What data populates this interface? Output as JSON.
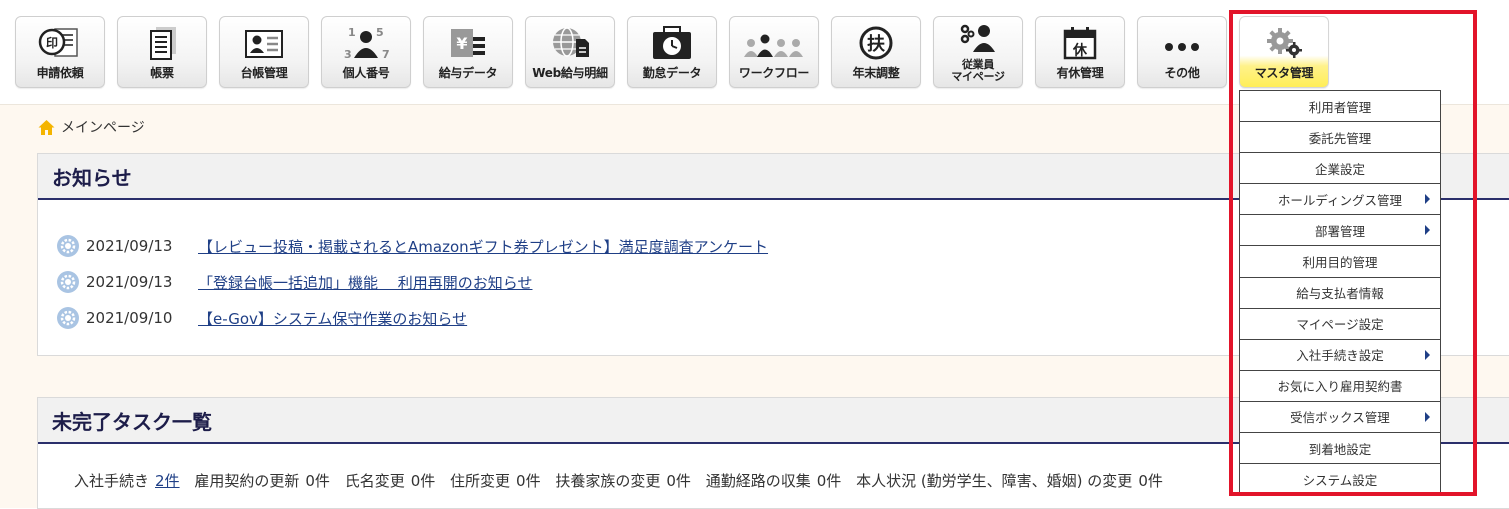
{
  "toolbar": {
    "items": [
      {
        "label": "申請依頼",
        "icon": "stamp-document-icon"
      },
      {
        "label": "帳票",
        "icon": "report-sheets-icon"
      },
      {
        "label": "台帳管理",
        "icon": "id-card-icon"
      },
      {
        "label": "個人番号",
        "icon": "my-number-icon",
        "digits": [
          "1",
          "5",
          "3",
          "7"
        ]
      },
      {
        "label": "給与データ",
        "icon": "salary-data-icon",
        "symbol": "¥"
      },
      {
        "label": "Web給与明細",
        "icon": "web-payslip-icon"
      },
      {
        "label": "勤怠データ",
        "icon": "attendance-clock-icon"
      },
      {
        "label": "ワークフロー",
        "icon": "workflow-people-icon"
      },
      {
        "label": "年末調整",
        "icon": "year-end-adjust-icon",
        "symbol": "扶"
      },
      {
        "label_line1": "従業員",
        "label_line2": "マイページ",
        "icon": "employee-mypage-icon"
      },
      {
        "label": "有休管理",
        "icon": "paid-leave-calendar-icon",
        "symbol": "休"
      },
      {
        "label": "その他",
        "icon": "more-dots-icon"
      },
      {
        "label": "マスタ管理",
        "icon": "gears-icon"
      }
    ]
  },
  "breadcrumb": {
    "label": "メインページ"
  },
  "notices": {
    "title": "お知らせ",
    "items": [
      {
        "date": "2021/09/13",
        "text": "【レビュー投稿・掲載されるとAmazonギフト券プレゼント】満足度調査アンケート"
      },
      {
        "date": "2021/09/13",
        "text": "「登録台帳一括追加」機能　 利用再開のお知らせ"
      },
      {
        "date": "2021/09/10",
        "text": "【e-Gov】システム保守作業のお知らせ"
      }
    ]
  },
  "tasks": {
    "title": "未完了タスク一覧",
    "items": [
      {
        "label": "入社手続き",
        "count": "2件",
        "link": true
      },
      {
        "label": "雇用契約の更新",
        "count": "0件"
      },
      {
        "label": "氏名変更",
        "count": "0件"
      },
      {
        "label": "住所変更",
        "count": "0件"
      },
      {
        "label": "扶養家族の変更",
        "count": "0件"
      },
      {
        "label": "通勤経路の収集",
        "count": "0件"
      },
      {
        "label": "本人状況 (勤労学生、障害、婚姻) の変更",
        "count": "0件"
      }
    ]
  },
  "master_menu": {
    "items": [
      {
        "label": "利用者管理",
        "submenu": false
      },
      {
        "label": "委託先管理",
        "submenu": false
      },
      {
        "label": "企業設定",
        "submenu": false
      },
      {
        "label": "ホールディングス管理",
        "submenu": true
      },
      {
        "label": "部署管理",
        "submenu": true
      },
      {
        "label": "利用目的管理",
        "submenu": false
      },
      {
        "label": "給与支払者情報",
        "submenu": false
      },
      {
        "label": "マイページ設定",
        "submenu": false
      },
      {
        "label": "入社手続き設定",
        "submenu": true
      },
      {
        "label": "お気に入り雇用契約書",
        "submenu": false
      },
      {
        "label": "受信ボックス管理",
        "submenu": true
      },
      {
        "label": "到着地設定",
        "submenu": false
      },
      {
        "label": "システム設定",
        "submenu": false
      }
    ]
  },
  "colors": {
    "accent_navy": "#1d1d4a",
    "link": "#1f3f86",
    "highlight": "#e2142a",
    "active_tab": "#ffee58"
  }
}
